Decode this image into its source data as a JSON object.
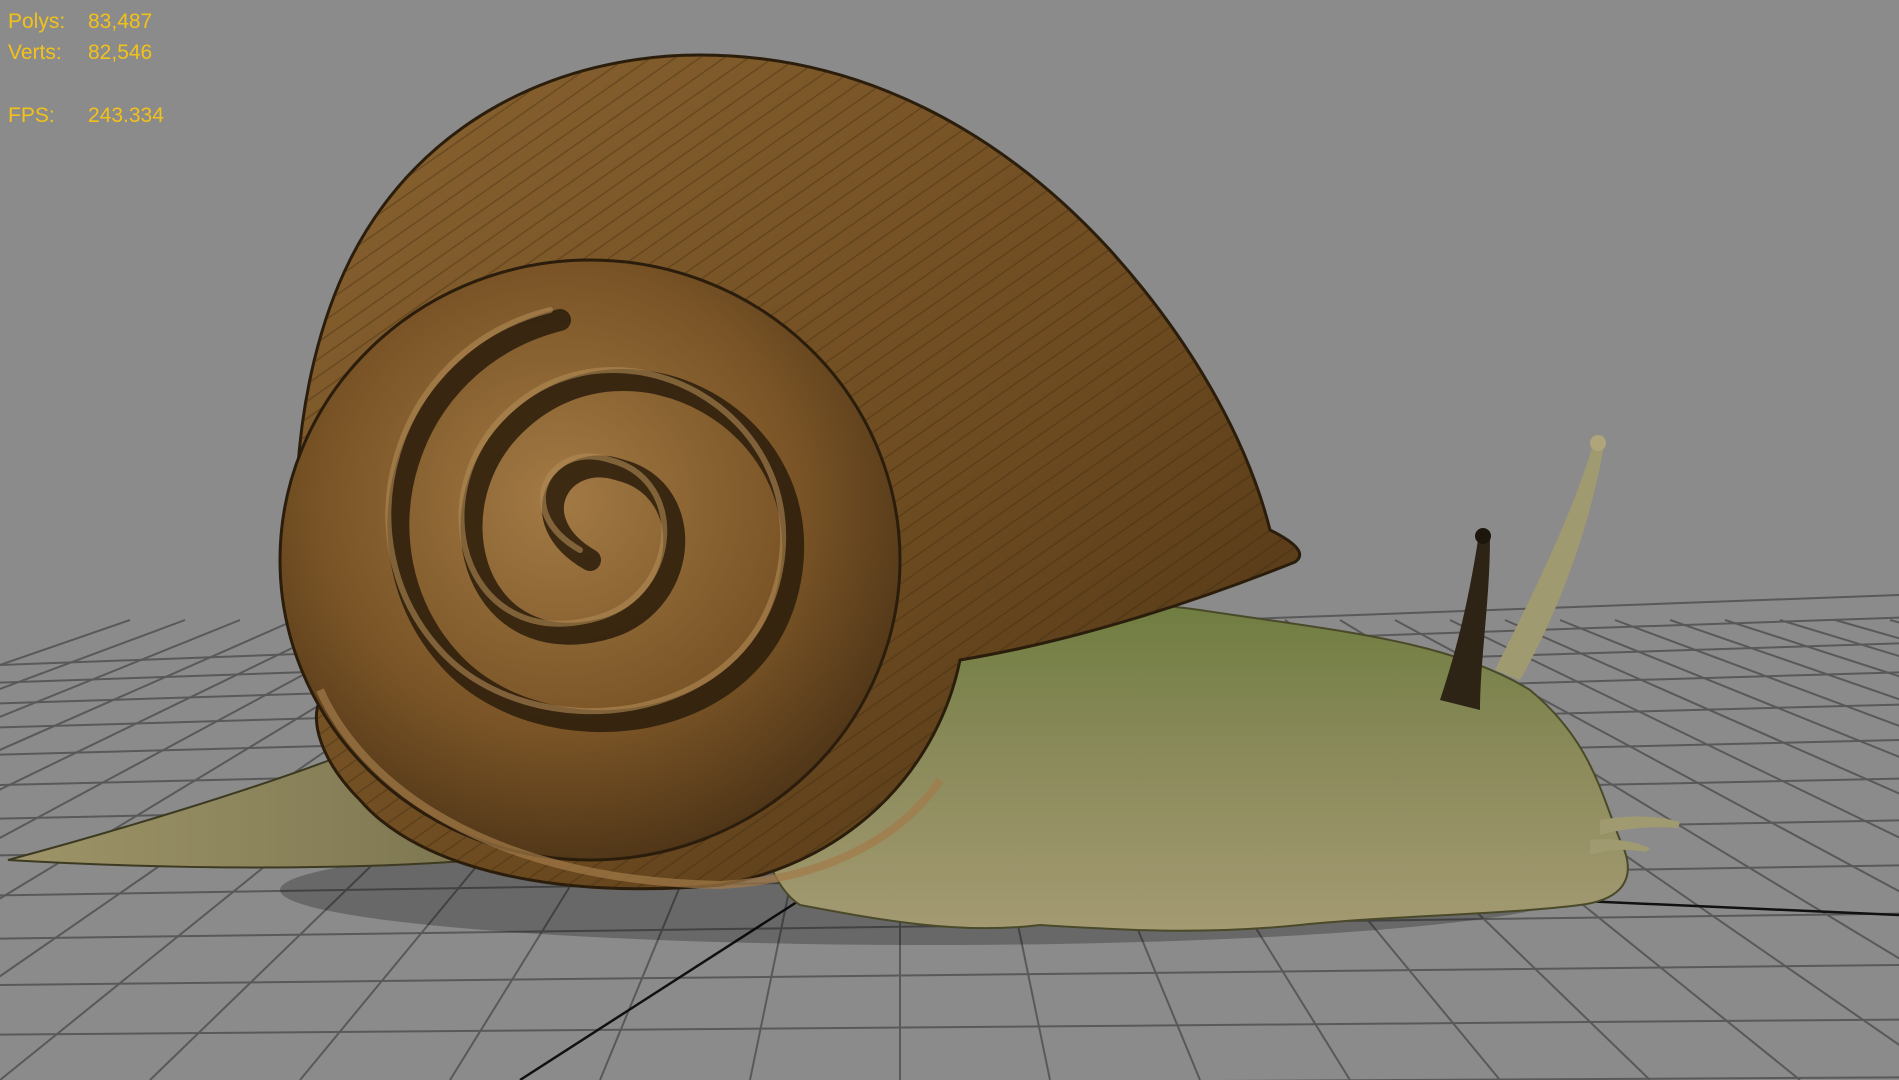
{
  "viewport": {
    "background_color": "#8b8b8b",
    "grid_color": "#595959",
    "axis_color": "#111111",
    "object": "snail-model"
  },
  "stats": {
    "polys_label": "Polys:",
    "polys_value": "83,487",
    "verts_label": "Verts:",
    "verts_value": "82,546",
    "fps_label": "FPS:",
    "fps_value": "243.334",
    "text_color": "#f2c21a"
  }
}
